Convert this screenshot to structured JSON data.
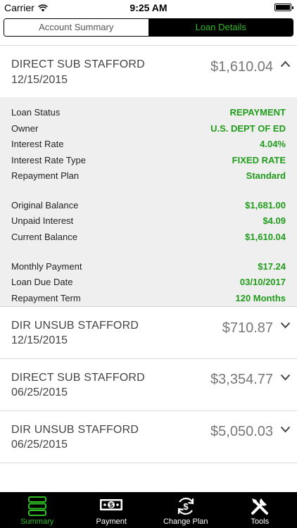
{
  "status_bar": {
    "carrier": "Carrier",
    "time": "9:25 AM"
  },
  "segments": {
    "account_summary": "Account Summary",
    "loan_details": "Loan Details",
    "selected": "Loan Details"
  },
  "loans": [
    {
      "name": "DIRECT SUB STAFFORD",
      "date": "12/15/2015",
      "amount": "$1,610.04",
      "expanded": true
    },
    {
      "name": "DIR UNSUB STAFFORD",
      "date": "12/15/2015",
      "amount": "$710.87",
      "expanded": false
    },
    {
      "name": "DIRECT SUB STAFFORD",
      "date": "06/25/2015",
      "amount": "$3,354.77",
      "expanded": false
    },
    {
      "name": "DIR UNSUB STAFFORD",
      "date": "06/25/2015",
      "amount": "$5,050.03",
      "expanded": false
    }
  ],
  "details": {
    "loan_status": {
      "label": "Loan Status",
      "value": "REPAYMENT"
    },
    "owner": {
      "label": "Owner",
      "value": "U.S. DEPT OF ED"
    },
    "interest_rate": {
      "label": "Interest Rate",
      "value": "4.04%"
    },
    "interest_rate_type": {
      "label": "Interest Rate Type",
      "value": "FIXED RATE"
    },
    "repayment_plan": {
      "label": "Repayment Plan",
      "value": "Standard"
    },
    "original_balance": {
      "label": "Original Balance",
      "value": "$1,681.00"
    },
    "unpaid_interest": {
      "label": "Unpaid Interest",
      "value": "$4.09"
    },
    "current_balance": {
      "label": "Current Balance",
      "value": "$1,610.04"
    },
    "monthly_payment": {
      "label": "Monthly Payment",
      "value": "$17.24"
    },
    "loan_due_date": {
      "label": "Loan Due Date",
      "value": "03/10/2017"
    },
    "repayment_term": {
      "label": "Repayment Term",
      "value": "120 Months"
    }
  },
  "tabbar": {
    "items": [
      {
        "label": "Summary",
        "icon": "summary-stack-icon",
        "active": true
      },
      {
        "label": "Payment",
        "icon": "dollar-bill-icon",
        "active": false
      },
      {
        "label": "Change Plan",
        "icon": "dollar-cycle-icon",
        "active": false
      },
      {
        "label": "Tools",
        "icon": "tools-icon",
        "active": false
      }
    ]
  },
  "colors": {
    "accent_green": "#2ebd25",
    "value_green": "#1f9c1a",
    "details_bg": "#efefef",
    "amount_gray": "#777777"
  }
}
